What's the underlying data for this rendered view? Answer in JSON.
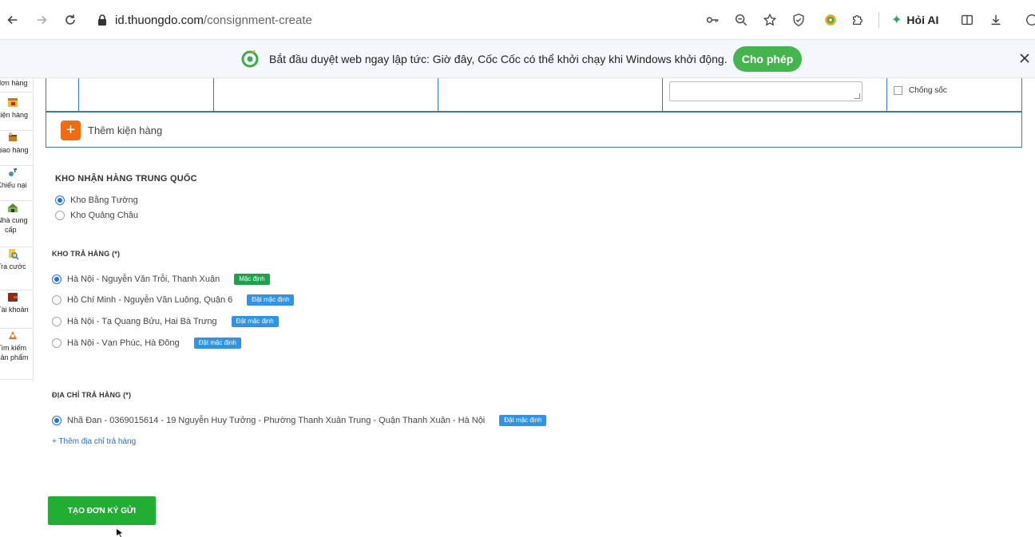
{
  "browser": {
    "url_host": "id.thuongdo.com",
    "url_path": "/consignment-create",
    "ai_label": "Hỏi AI"
  },
  "infobar": {
    "message": "Bắt đầu duyệt web ngay lập tức: Giờ đây, Cốc Cốc có thể khởi chạy khi Windows khởi động.",
    "allow_label": "Cho phép"
  },
  "sidebar": {
    "items": [
      {
        "label": "đơn hàng",
        "icon": "order-icon"
      },
      {
        "label": "kiện hàng",
        "icon": "package-icon"
      },
      {
        "label": "giao hàng",
        "icon": "delivery-icon"
      },
      {
        "label": "Khiếu nại",
        "icon": "complaint-icon"
      },
      {
        "label": "Nhà cung",
        "label2": "cấp",
        "icon": "supplier-icon"
      },
      {
        "label": "Tra cước",
        "icon": "fee-lookup-icon"
      },
      {
        "label": "Tài khoản",
        "icon": "wallet-icon"
      },
      {
        "label": "Tìm kiếm",
        "label2": "sản phẩm",
        "icon": "product-search-icon"
      }
    ]
  },
  "table": {
    "checkbox_label": "Chống sốc",
    "add_package_label": "Thêm kiện hàng"
  },
  "china_warehouse": {
    "title": "KHO NHẬN HÀNG TRUNG QUỐC",
    "options": [
      {
        "label": "Kho Bằng Tường",
        "selected": true
      },
      {
        "label": "Kho Quảng Châu",
        "selected": false
      }
    ]
  },
  "return_warehouse": {
    "title": "KHO TRẢ HÀNG (*)",
    "options": [
      {
        "label": "Hà Nội - Nguyễn Văn Trỗi, Thanh Xuân",
        "badge": "Mặc định",
        "selected": true
      },
      {
        "label": "Hồ Chí Minh - Nguyễn Văn Luông, Quận 6",
        "badge": "Đặt mặc định",
        "selected": false
      },
      {
        "label": "Hà Nội - Tạ Quang Bửu, Hai Bà Trưng",
        "badge": "Đặt mặc định",
        "selected": false
      },
      {
        "label": "Hà Nội - Vạn Phúc, Hà Đông",
        "badge": "Đặt mặc định",
        "selected": false
      }
    ]
  },
  "return_address": {
    "title": "ĐỊA CHỈ TRẢ HÀNG (*)",
    "address": "Nhã Đan - 0369015614 - 19 Nguyễn Huy Tưởng - Phường Thanh Xuân Trung - Quận Thanh Xuân - Hà Nội",
    "badge": "Đặt mặc định",
    "add_link": "+ Thêm địa chỉ trả hàng"
  },
  "submit_label": "TẠO ĐƠN KÝ GỬI",
  "colors": {
    "accent_green": "#22ad33",
    "badge_blue": "#2f93e8",
    "orange": "#f36a10",
    "border_blue": "#3a78c6"
  }
}
